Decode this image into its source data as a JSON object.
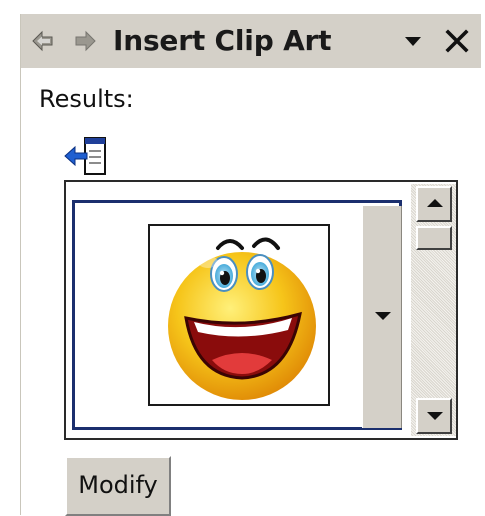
{
  "taskpane": {
    "title": "Insert Clip Art",
    "icons": {
      "back": "back-arrow-icon",
      "forward": "forward-arrow-icon",
      "menu": "chevron-down-icon",
      "close": "close-icon"
    }
  },
  "results": {
    "label": "Results:",
    "back_icon": "back-to-results-icon",
    "items": [
      {
        "icon": "smiley-face-clip-art",
        "selected": true
      }
    ]
  },
  "scrollbar": {
    "up_icon": "scroll-up-arrow-icon",
    "down_icon": "scroll-down-arrow-icon"
  },
  "actions": {
    "modify_label": "Modify"
  },
  "colors": {
    "titlebar_bg": "#d4d0c8",
    "selection_border": "#1b2f6e",
    "smiley_yellow": "#f6c51a",
    "button_face": "#d4d0c8"
  }
}
